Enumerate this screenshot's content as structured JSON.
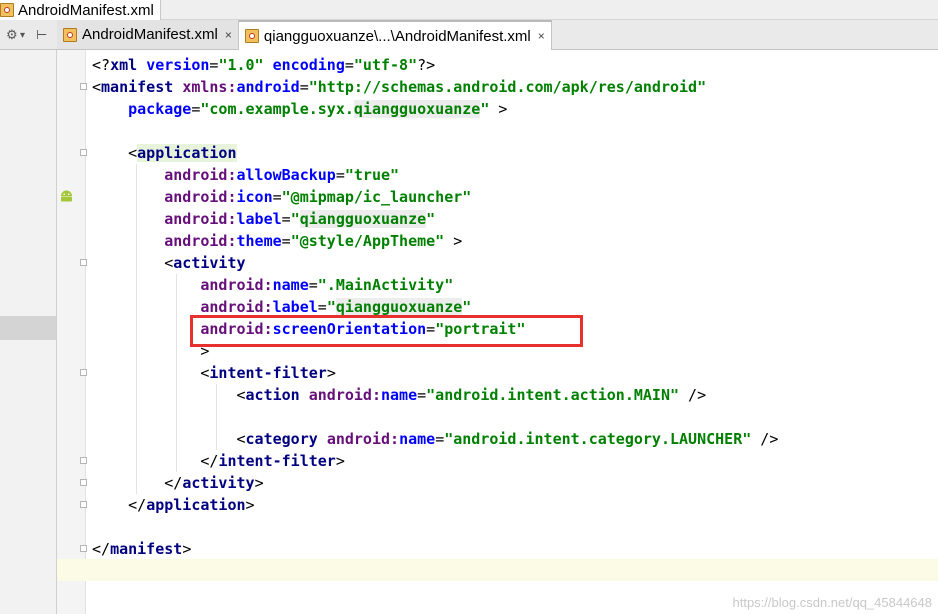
{
  "breadcrumb": {
    "label": "AndroidManifest.xml"
  },
  "toolbar": {
    "settings_glyph": "⚙",
    "pin_glyph": "⊢"
  },
  "tabs": [
    {
      "label": "AndroidManifest.xml",
      "close": "×",
      "active": false
    },
    {
      "label": "qiangguoxuanze\\...\\AndroidManifest.xml",
      "close": "×",
      "active": true
    }
  ],
  "code_lines": [
    [
      {
        "c": "pl",
        "t": "<?"
      },
      {
        "c": "tag",
        "t": "xml "
      },
      {
        "c": "attr",
        "t": "version"
      },
      {
        "c": "pl",
        "t": "="
      },
      {
        "c": "val",
        "t": "\"1.0\""
      },
      {
        "c": "pl",
        "t": " "
      },
      {
        "c": "attr",
        "t": "encoding"
      },
      {
        "c": "pl",
        "t": "="
      },
      {
        "c": "val",
        "t": "\"utf-8\""
      },
      {
        "c": "pl",
        "t": "?>"
      }
    ],
    [
      {
        "c": "pl",
        "t": "<"
      },
      {
        "c": "tag",
        "t": "manifest "
      },
      {
        "c": "ns",
        "t": "xmlns:"
      },
      {
        "c": "attr",
        "t": "android"
      },
      {
        "c": "pl",
        "t": "="
      },
      {
        "c": "val",
        "t": "\"http://schemas.android.com/apk/res/android\""
      }
    ],
    [
      {
        "c": "pl",
        "t": "    "
      },
      {
        "c": "attr",
        "t": "package"
      },
      {
        "c": "pl",
        "t": "="
      },
      {
        "c": "val",
        "t": "\"com.example.syx."
      },
      {
        "c": "valh",
        "t": "qiangguoxuanze"
      },
      {
        "c": "val",
        "t": "\""
      },
      {
        "c": "pl",
        "t": " >"
      }
    ],
    [],
    [
      {
        "c": "pl",
        "t": "    <"
      },
      {
        "c": "tagh",
        "t": "application"
      }
    ],
    [
      {
        "c": "pl",
        "t": "        "
      },
      {
        "c": "ns",
        "t": "android:"
      },
      {
        "c": "attr",
        "t": "allowBackup"
      },
      {
        "c": "pl",
        "t": "="
      },
      {
        "c": "val",
        "t": "\"true\""
      }
    ],
    [
      {
        "c": "pl",
        "t": "        "
      },
      {
        "c": "ns",
        "t": "android:"
      },
      {
        "c": "attr",
        "t": "icon"
      },
      {
        "c": "pl",
        "t": "="
      },
      {
        "c": "val",
        "t": "\"@mipmap/ic_launcher\""
      }
    ],
    [
      {
        "c": "pl",
        "t": "        "
      },
      {
        "c": "ns",
        "t": "android:"
      },
      {
        "c": "attr",
        "t": "label"
      },
      {
        "c": "pl",
        "t": "="
      },
      {
        "c": "val",
        "t": "\""
      },
      {
        "c": "valh",
        "t": "qiangguoxuanze"
      },
      {
        "c": "val",
        "t": "\""
      }
    ],
    [
      {
        "c": "pl",
        "t": "        "
      },
      {
        "c": "ns",
        "t": "android:"
      },
      {
        "c": "attr",
        "t": "theme"
      },
      {
        "c": "pl",
        "t": "="
      },
      {
        "c": "val",
        "t": "\"@style/AppTheme\""
      },
      {
        "c": "pl",
        "t": " >"
      }
    ],
    [
      {
        "c": "pl",
        "t": "        <"
      },
      {
        "c": "tag",
        "t": "activity"
      }
    ],
    [
      {
        "c": "pl",
        "t": "            "
      },
      {
        "c": "ns",
        "t": "android:"
      },
      {
        "c": "attr",
        "t": "name"
      },
      {
        "c": "pl",
        "t": "="
      },
      {
        "c": "val",
        "t": "\".MainActivity\""
      }
    ],
    [
      {
        "c": "pl",
        "t": "            "
      },
      {
        "c": "ns",
        "t": "android:"
      },
      {
        "c": "attr",
        "t": "label"
      },
      {
        "c": "pl",
        "t": "="
      },
      {
        "c": "val",
        "t": "\""
      },
      {
        "c": "valh",
        "t": "qiangguoxuanze"
      },
      {
        "c": "val",
        "t": "\""
      }
    ],
    [
      {
        "c": "pl",
        "t": "            "
      },
      {
        "c": "ns",
        "t": "android:"
      },
      {
        "c": "attr",
        "t": "screenOrientation"
      },
      {
        "c": "pl",
        "t": "="
      },
      {
        "c": "val",
        "t": "\"portrait\""
      }
    ],
    [
      {
        "c": "pl",
        "t": "            >"
      }
    ],
    [
      {
        "c": "pl",
        "t": "            <"
      },
      {
        "c": "tag",
        "t": "intent-filter"
      },
      {
        "c": "pl",
        "t": ">"
      }
    ],
    [
      {
        "c": "pl",
        "t": "                <"
      },
      {
        "c": "tag",
        "t": "action "
      },
      {
        "c": "ns",
        "t": "android:"
      },
      {
        "c": "attr",
        "t": "name"
      },
      {
        "c": "pl",
        "t": "="
      },
      {
        "c": "val",
        "t": "\"android.intent.action.MAIN\""
      },
      {
        "c": "pl",
        "t": " />"
      }
    ],
    [],
    [
      {
        "c": "pl",
        "t": "                <"
      },
      {
        "c": "tag",
        "t": "category "
      },
      {
        "c": "ns",
        "t": "android:"
      },
      {
        "c": "attr",
        "t": "name"
      },
      {
        "c": "pl",
        "t": "="
      },
      {
        "c": "val",
        "t": "\"android.intent.category.LAUNCHER\""
      },
      {
        "c": "pl",
        "t": " />"
      }
    ],
    [
      {
        "c": "pl",
        "t": "            </"
      },
      {
        "c": "tag",
        "t": "intent-filter"
      },
      {
        "c": "pl",
        "t": ">"
      }
    ],
    [
      {
        "c": "pl",
        "t": "        </"
      },
      {
        "c": "tag",
        "t": "activity"
      },
      {
        "c": "pl",
        "t": ">"
      }
    ],
    [
      {
        "c": "pl",
        "t": "    </"
      },
      {
        "c": "tag",
        "t": "application"
      },
      {
        "c": "pl",
        "t": ">"
      }
    ],
    [],
    [
      {
        "c": "pl",
        "t": "</"
      },
      {
        "c": "tag",
        "t": "manifest"
      },
      {
        "c": "pl",
        "t": ">"
      }
    ],
    []
  ],
  "highlight": {
    "color": "#e8302f",
    "target_line": 13
  },
  "gutter_icons": [
    "android-icon"
  ],
  "colors": {
    "tag": "#000080",
    "namespace": "#660e7a",
    "attribute": "#0000ff",
    "value": "#008000",
    "caret_line": "#fcfbe5"
  },
  "watermark": "https://blog.csdn.net/qq_45844648"
}
